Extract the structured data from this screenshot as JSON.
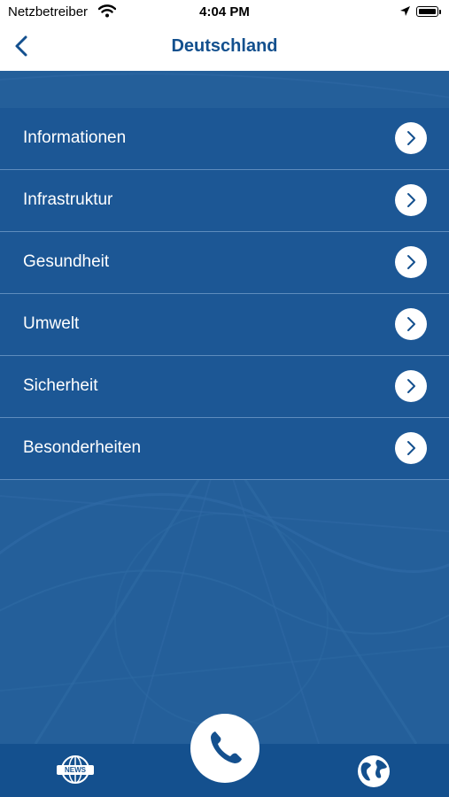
{
  "status_bar": {
    "carrier": "Netzbetreiber",
    "time": "4:04 PM"
  },
  "nav": {
    "title": "Deutschland",
    "back_icon": "chevron-left-icon"
  },
  "menu": {
    "items": [
      {
        "label": "Informationen"
      },
      {
        "label": "Infrastruktur"
      },
      {
        "label": "Gesundheit"
      },
      {
        "label": "Umwelt"
      },
      {
        "label": "Sicherheit"
      },
      {
        "label": "Besonderheiten"
      }
    ]
  },
  "tab_bar": {
    "news_label": "NEWS",
    "news_icon": "news-globe-icon",
    "call_icon": "phone-icon",
    "globe_icon": "globe-icon"
  },
  "colors": {
    "primary": "#14508e",
    "menu_bg": "#1c5795",
    "divider": "#5e8cbd",
    "background": "#245f9a"
  }
}
